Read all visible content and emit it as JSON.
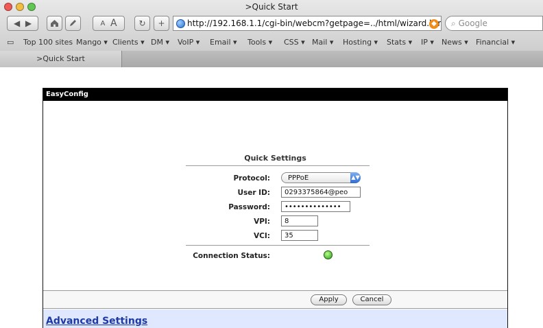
{
  "browser": {
    "title": ">Quick Start",
    "font_size_buttons": [
      "A",
      "A"
    ],
    "url": "http://192.168.1.1/cgi-bin/webcm?getpage=../html/wizard.htm",
    "search_placeholder": "Google",
    "bookmarks": [
      {
        "label": "Top 100 sites"
      },
      {
        "label": "Mango ▾"
      },
      {
        "label": "Clients ▾"
      },
      {
        "label": "DM ▾"
      },
      {
        "label": "VoIP ▾"
      },
      {
        "label": "Email ▾"
      },
      {
        "label": "Tools ▾"
      },
      {
        "label": "CSS ▾"
      },
      {
        "label": "Mail ▾"
      },
      {
        "label": "Hosting ▾"
      },
      {
        "label": "Stats ▾"
      },
      {
        "label": "IP ▾"
      },
      {
        "label": "News ▾"
      },
      {
        "label": "Financial ▾"
      }
    ],
    "tab_title": ">Quick Start"
  },
  "page": {
    "header": "EasyConfig",
    "section_title": "Quick Settings",
    "fields": {
      "protocol_label": "Protocol:",
      "protocol_value": "PPPoE",
      "userid_label": "User ID:",
      "userid_value": "0293375864@peo",
      "password_label": "Password:",
      "password_value": "••••••••••••••",
      "vpi_label": "VPI:",
      "vpi_value": "8",
      "vci_label": "VCI:",
      "vci_value": "35"
    },
    "connection_status_label": "Connection Status:",
    "connection_status_color": "#38a51f",
    "apply_label": "Apply",
    "cancel_label": "Cancel",
    "advanced_link": "Advanced Settings"
  },
  "icons": {
    "home": "home-icon",
    "edit": "pencil-icon",
    "reload": "reload-icon",
    "add": "plus-icon",
    "site": "globe-icon",
    "feed": "rss-icon",
    "bookmarks": "book-icon"
  }
}
